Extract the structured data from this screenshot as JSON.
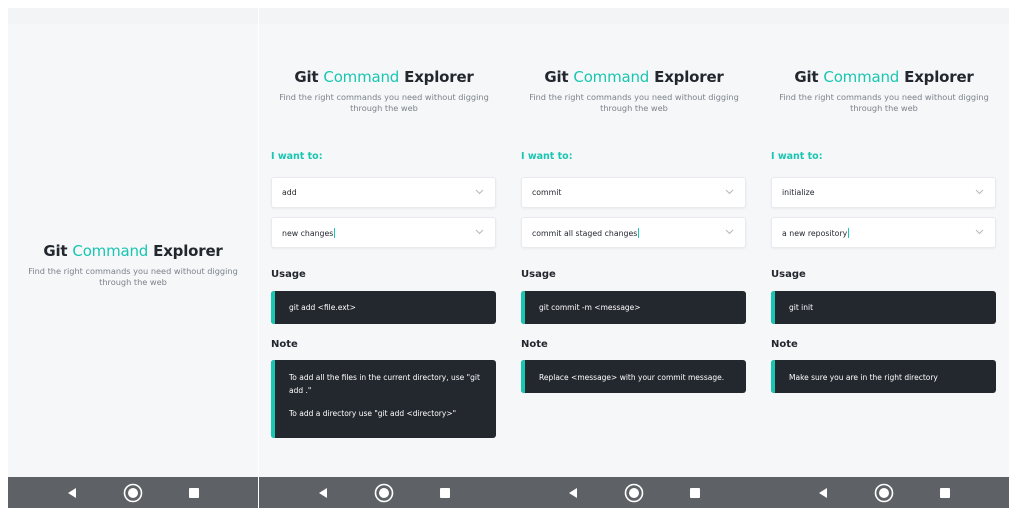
{
  "app": {
    "title_part1": "Git",
    "title_accent": "Command",
    "title_part2": "Explorer",
    "subtitle": "Find the right commands you need without digging through the web"
  },
  "labels": {
    "i_want_to": "I want to:",
    "usage": "Usage",
    "note": "Note"
  },
  "screens": [
    {
      "action": "add",
      "option": "new changes",
      "usage": "git add <file.ext>",
      "note_lines": [
        "To add all the files in the current directory, use \"git add .\"",
        "To add a directory use \"git add <directory>\""
      ]
    },
    {
      "action": "commit",
      "option": "commit all staged changes",
      "usage": "git commit -m <message>",
      "note_lines": [
        "Replace <message> with your commit message."
      ]
    },
    {
      "action": "initialize",
      "option": "a new repository",
      "usage": "git init",
      "note_lines": [
        "Make sure you are in the right directory"
      ]
    }
  ],
  "icons": {
    "select_arrow": "chevron-down-icon",
    "nav_back": "back-triangle-icon",
    "nav_home": "home-circle-icon",
    "nav_recent": "recent-square-icon"
  },
  "colors": {
    "accent": "#19c6b1",
    "dark_box": "#23272e",
    "background": "#f6f7f9",
    "nav_bar": "#5e6165"
  }
}
